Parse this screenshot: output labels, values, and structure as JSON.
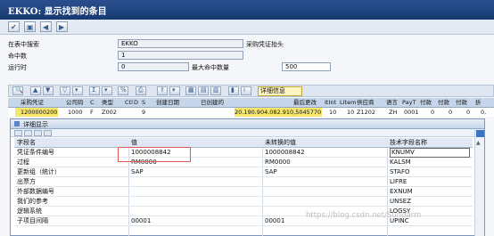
{
  "window": {
    "title": "EKKO: 显示找到的条目"
  },
  "selection": {
    "table_label": "在表中搜索",
    "table_value": "EKKO",
    "table_desc": "采购凭证抬头",
    "hits_label": "命中数",
    "hits_value": "1",
    "runtime_label": "运行时",
    "runtime_value": "0",
    "maxhits_label": "最大命中数量",
    "maxhits_value": "500"
  },
  "grid_toolbar": {
    "detail_button": "详细信息"
  },
  "grid": {
    "headers": [
      "采购凭证",
      "公司码",
      "C",
      "类型",
      "Ctl",
      "D",
      "S",
      "创建日期",
      "已创建的",
      "最后更改",
      "ItInt",
      "LItem",
      "供应商",
      "语言",
      "PayT",
      "付款",
      "付款",
      "付款",
      "折"
    ],
    "row": [
      "1200000200",
      "1000",
      "F",
      "Z002",
      "",
      "",
      "9",
      "",
      "",
      "20.190.904.082.910,5045770",
      "10",
      "10",
      "Z1202",
      "ZH",
      "0001",
      "0",
      "0",
      "0",
      "0,"
    ]
  },
  "dialog": {
    "title": "详细显示",
    "columns": [
      "字段名",
      "值",
      "未转换的值",
      "技术字段名称"
    ],
    "rows": [
      [
        "凭证条件编号",
        "1000008842",
        "1000008842",
        "KNUMV"
      ],
      [
        "过程",
        "RM0000",
        "RM0000",
        "KALSM"
      ],
      [
        "更新组（统计）",
        "SAP",
        "SAP",
        "STAFO"
      ],
      [
        "出票方",
        "",
        "",
        "LIFRE"
      ],
      [
        "外部数据编号",
        "",
        "",
        "EXNUM"
      ],
      [
        "我们的参考",
        "",
        "",
        "UNSEZ"
      ],
      [
        "逻辑系统",
        "",
        "",
        "LOGSY"
      ],
      [
        "子项目间隔",
        "00001",
        "00001",
        "UPINC"
      ]
    ]
  },
  "watermark": "https://blog.csdn.net/Sundarm"
}
